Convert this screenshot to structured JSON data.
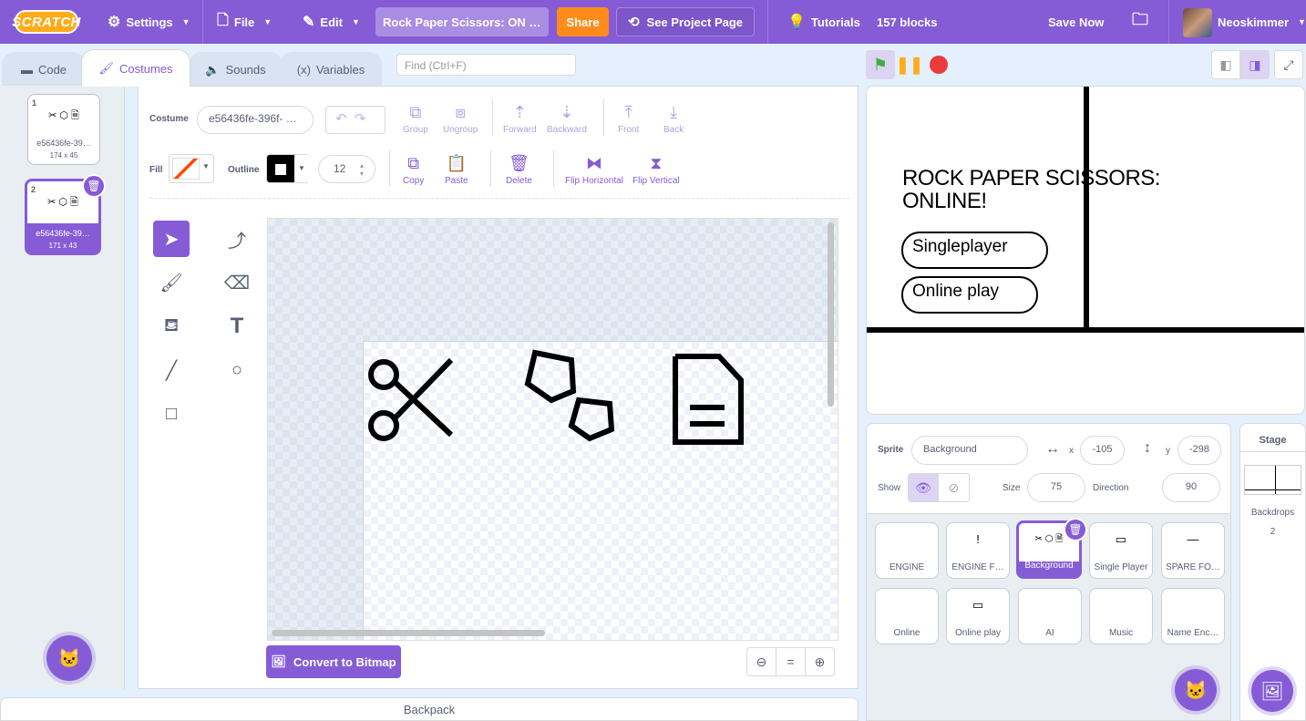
{
  "menu": {
    "logo": "SCRATCH",
    "settings": "Settings",
    "file": "File",
    "edit": "Edit",
    "project_title": "Rock Paper Scissors: ON …",
    "share": "Share",
    "see_project_page": "See Project Page",
    "tutorials": "Tutorials",
    "blocks": "157 blocks",
    "save_now": "Save Now",
    "username": "Neoskimmer"
  },
  "tabs": {
    "code": "Code",
    "costumes": "Costumes",
    "sounds": "Sounds",
    "variables": "Variables",
    "find_placeholder": "Find (Ctrl+F)"
  },
  "costumes": [
    {
      "num": "1",
      "thumb": "✂ ⬡ 🗎",
      "name": "e56436fe-39…",
      "dims": "174 x 45"
    },
    {
      "num": "2",
      "thumb": "✂ ⬡ 🗎",
      "name": "e56436fe-39…",
      "dims": "171 x 43"
    }
  ],
  "editor": {
    "costume_label": "Costume",
    "costume_name": "e56436fe-396f- …",
    "group": "Group",
    "ungroup": "Ungroup",
    "forward": "Forward",
    "backward": "Backward",
    "front": "Front",
    "back": "Back",
    "fill_label": "Fill",
    "outline_label": "Outline",
    "outline_size": "12",
    "copy": "Copy",
    "paste": "Paste",
    "delete": "Delete",
    "flip_h": "Flip Horizontal",
    "flip_v": "Flip Vertical",
    "convert_bitmap": "Convert to Bitmap",
    "zoom_reset": "="
  },
  "stage": {
    "title_line1": "ROCK PAPER SCISSORS:",
    "title_line2": "ONLINE!",
    "btn_single": "Singleplayer",
    "btn_online": "Online play"
  },
  "sprite_info": {
    "sprite_label": "Sprite",
    "sprite_name": "Background",
    "x_label": "x",
    "x_value": "-105",
    "y_label": "y",
    "y_value": "-298",
    "show_label": "Show",
    "size_label": "Size",
    "size_value": "75",
    "direction_label": "Direction",
    "direction_value": "90"
  },
  "sprites": [
    {
      "name": "ENGINE",
      "thumb": ""
    },
    {
      "name": "ENGINE F…",
      "thumb": "!"
    },
    {
      "name": "Background",
      "thumb": "✂ ⬡ 🗎"
    },
    {
      "name": "Single Player",
      "thumb": "▭"
    },
    {
      "name": "SPARE FO…",
      "thumb": "—"
    },
    {
      "name": "Online",
      "thumb": ""
    },
    {
      "name": "Online play",
      "thumb": "▭"
    },
    {
      "name": "AI",
      "thumb": ""
    },
    {
      "name": "Music",
      "thumb": ""
    },
    {
      "name": "Name Enc…",
      "thumb": ""
    }
  ],
  "stage_panel": {
    "title": "Stage",
    "backdrops_label": "Backdrops",
    "backdrops_count": "2"
  },
  "backpack": "Backpack",
  "colors": {
    "accent": "#855cd6",
    "share": "#ff8c1a",
    "fill_swatch": "#ff4c00",
    "outline_swatch": "#000000"
  }
}
